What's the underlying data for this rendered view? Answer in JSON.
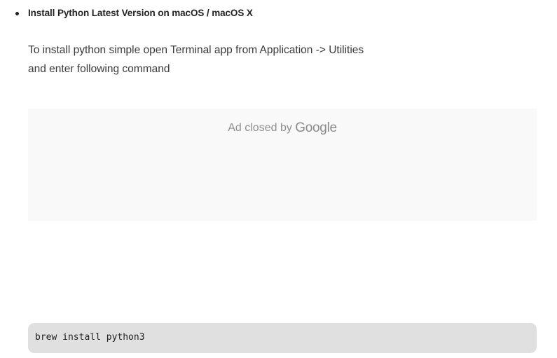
{
  "article": {
    "bullet_heading": "Install Python Latest Version on macOS / macOS X",
    "paragraph_line_1": "To install python simple open Terminal app from Application -> Utilities",
    "paragraph_line_2": "and enter following command"
  },
  "ad": {
    "closed_label": "Ad closed by",
    "brand": "Google"
  },
  "code": {
    "command": "brew install python3"
  }
}
